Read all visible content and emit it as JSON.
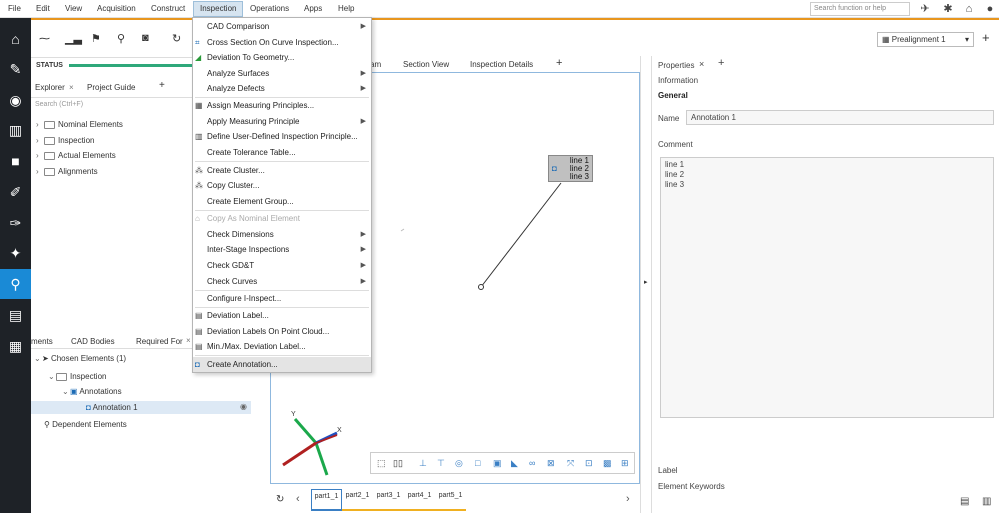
{
  "menubar": {
    "items": [
      "File",
      "Edit",
      "View",
      "Acquisition",
      "Construct",
      "Inspection",
      "Operations",
      "Apps",
      "Help"
    ],
    "search_placeholder": "Search function or help"
  },
  "status": {
    "label": "STATUS"
  },
  "explorer": {
    "tabs": [
      "Explorer",
      "Project Guide"
    ],
    "add": "+",
    "search_placeholder": "Search (Ctrl+F)",
    "tree": [
      "Nominal Elements",
      "Inspection",
      "Actual Elements",
      "Alignments"
    ]
  },
  "lower": {
    "tabs": [
      "ments",
      "CAD Bodies",
      "Required For"
    ],
    "close": "×",
    "tree": {
      "chosen": "Chosen Elements (1)",
      "inspection": "Inspection",
      "annotations": "Annotations",
      "annotation1": "Annotation 1",
      "dependent": "Dependent Elements"
    }
  },
  "view": {
    "tabs": [
      "am",
      "Section View",
      "Inspection Details"
    ],
    "add": "+",
    "annotation_lines": [
      "line 1",
      "line 2",
      "line 3"
    ],
    "axes": {
      "x": "X",
      "y": "Y"
    },
    "parts": [
      "part1_1",
      "part2_1",
      "part3_1",
      "part4_1",
      "part5_1"
    ]
  },
  "realignment": {
    "value": "Prealignment 1"
  },
  "properties": {
    "tab": "Properties",
    "close": "×",
    "add": "+",
    "information": "Information",
    "general": "General",
    "name_label": "Name",
    "name_value": "Annotation 1",
    "comment_label": "Comment",
    "comment_lines": [
      "line 1",
      "line 2",
      "line 3"
    ],
    "label_label": "Label",
    "keywords_label": "Element Keywords"
  },
  "menu": {
    "items": [
      {
        "label": "CAD Comparison",
        "icon": "",
        "submenu": true
      },
      {
        "label": "Cross Section On Curve Inspection...",
        "icon": "cross-section-icon",
        "submenu": false
      },
      {
        "label": "Deviation To Geometry...",
        "icon": "deviation-geometry-icon",
        "submenu": false
      },
      {
        "label": "Analyze Surfaces",
        "icon": "",
        "submenu": true
      },
      {
        "label": "Analyze Defects",
        "icon": "",
        "submenu": true
      },
      {
        "label": "Assign Measuring Principles...",
        "icon": "assign-principles-icon",
        "submenu": false
      },
      {
        "label": "Apply Measuring Principle",
        "icon": "",
        "submenu": true
      },
      {
        "label": "Define User-Defined Inspection Principle...",
        "icon": "define-principle-icon",
        "submenu": false
      },
      {
        "label": "Create Tolerance Table...",
        "icon": "",
        "submenu": false
      },
      {
        "label": "Create Cluster...",
        "icon": "cluster-icon",
        "submenu": false
      },
      {
        "label": "Copy Cluster...",
        "icon": "copy-cluster-icon",
        "submenu": false
      },
      {
        "label": "Create Element Group...",
        "icon": "",
        "submenu": false
      },
      {
        "label": "Copy As Nominal Element",
        "icon": "copy-nominal-icon",
        "submenu": false,
        "disabled": true
      },
      {
        "label": "Check Dimensions",
        "icon": "",
        "submenu": true
      },
      {
        "label": "Inter-Stage Inspections",
        "icon": "",
        "submenu": true
      },
      {
        "label": "Check GD&T",
        "icon": "",
        "submenu": true
      },
      {
        "label": "Check Curves",
        "icon": "",
        "submenu": true
      },
      {
        "label": "Configure I-Inspect...",
        "icon": "",
        "submenu": false
      },
      {
        "label": "Deviation Label...",
        "icon": "deviation-label-icon",
        "submenu": false
      },
      {
        "label": "Deviation Labels On Point Cloud...",
        "icon": "deviation-cloud-icon",
        "submenu": false
      },
      {
        "label": "Min./Max. Deviation Label...",
        "icon": "minmax-label-icon",
        "submenu": false
      },
      {
        "label": "Create Annotation...",
        "icon": "annotation-icon",
        "submenu": false,
        "highlighted": true
      }
    ]
  },
  "colors": {
    "accent": "#1a8ad6",
    "orange": "#e8961e",
    "sidebar": "#1e2227",
    "status": "#2ea87a"
  }
}
